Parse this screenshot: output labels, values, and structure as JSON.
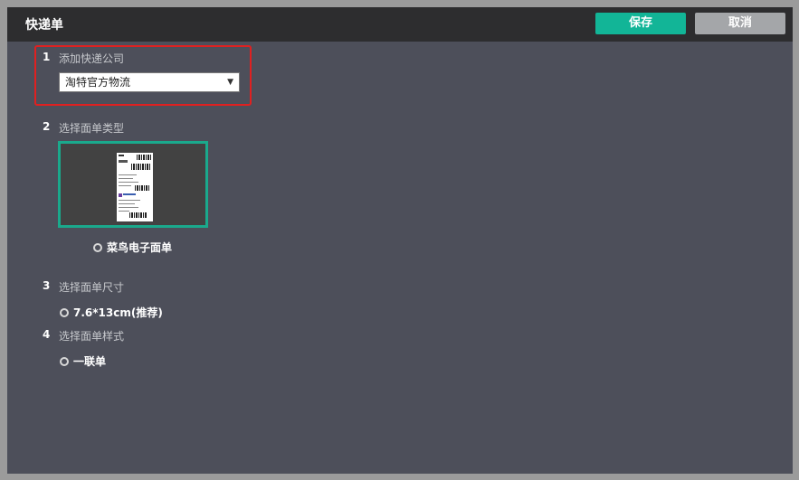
{
  "window": {
    "title": "快递单",
    "save_label": "保存",
    "cancel_label": "取消"
  },
  "steps": [
    {
      "num": "1",
      "label": "添加快递公司"
    },
    {
      "num": "2",
      "label": "选择面单类型"
    },
    {
      "num": "3",
      "label": "选择面单尺寸"
    },
    {
      "num": "4",
      "label": "选择面单样式"
    }
  ],
  "company_select": {
    "value": "淘特官方物流"
  },
  "waybill_type": {
    "option": "菜鸟电子面单"
  },
  "waybill_size": {
    "option": "7.6*13cm(推荐)"
  },
  "waybill_style": {
    "option": "一联单"
  },
  "colors": {
    "accent": "#12b597",
    "highlight": "#e02020",
    "panel": "#4d4f5a"
  }
}
